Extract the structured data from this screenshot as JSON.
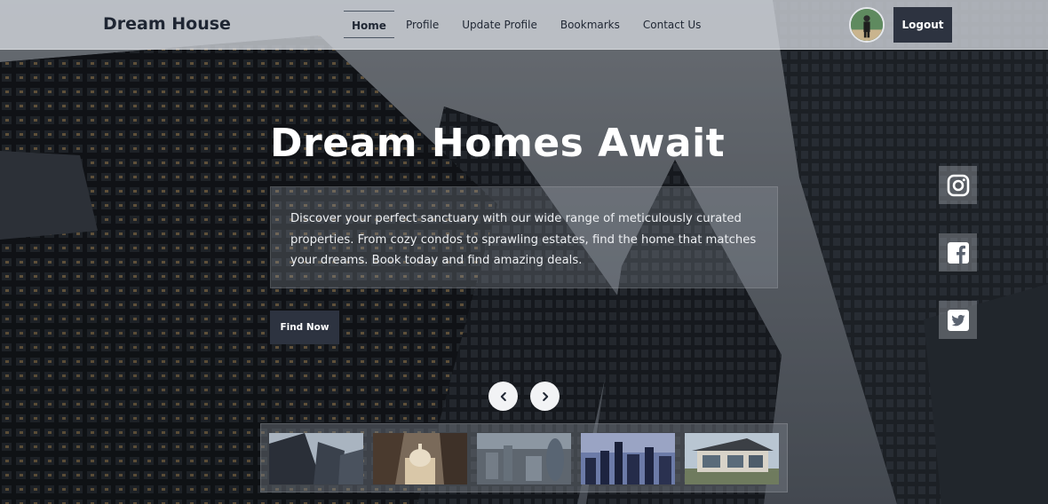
{
  "navbar": {
    "brand": "Dream House",
    "links": [
      {
        "label": "Home",
        "active": true
      },
      {
        "label": "Profile",
        "active": false
      },
      {
        "label": "Update Profile",
        "active": false
      },
      {
        "label": "Bookmarks",
        "active": false
      },
      {
        "label": "Contact Us",
        "active": false
      }
    ],
    "logout_label": "Logout"
  },
  "hero": {
    "title": "Dream Homes Await",
    "description": "Discover your perfect sanctuary with our wide range of meticulously curated properties. From cozy condos to sprawling estates, find the home that matches your dreams. Book today and find amazing deals.",
    "cta_label": "Find Now"
  },
  "social": [
    {
      "icon": "instagram-icon"
    },
    {
      "icon": "facebook-icon"
    },
    {
      "icon": "twitter-icon"
    }
  ],
  "carousel": {
    "prev_icon": "chevron-left-icon",
    "next_icon": "chevron-right-icon",
    "thumbnails": [
      {
        "icon": "skyscrapers-thumbnail"
      },
      {
        "icon": "cathedral-thumbnail"
      },
      {
        "icon": "city-aerial-thumbnail"
      },
      {
        "icon": "night-skyline-thumbnail"
      },
      {
        "icon": "modern-house-thumbnail"
      }
    ]
  },
  "colors": {
    "navbar_bg": "#d2d6dc",
    "button_bg": "#2d3340",
    "text_dark": "#1f2633",
    "text_light": "#ffffff"
  }
}
